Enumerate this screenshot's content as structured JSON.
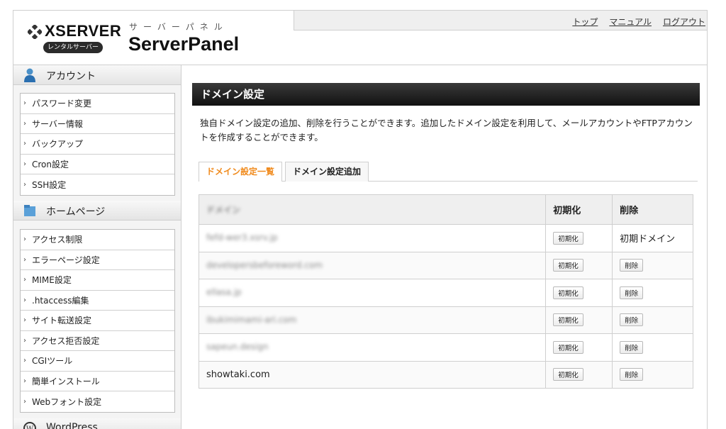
{
  "header": {
    "brand": "XSERVER",
    "rental_badge": "レンタルサーバー",
    "panel_sub": "サーバーパネル",
    "panel_title": "ServerPanel",
    "links": [
      "トップ",
      "マニュアル",
      "ログアウト"
    ]
  },
  "sidebar": {
    "sections": [
      {
        "title": "アカウント",
        "icon": "person-icon",
        "items": [
          "パスワード変更",
          "サーバー情報",
          "バックアップ",
          "Cron設定",
          "SSH設定"
        ]
      },
      {
        "title": "ホームページ",
        "icon": "folder-icon",
        "items": [
          "アクセス制限",
          "エラーページ設定",
          "MIME設定",
          ".htaccess編集",
          "サイト転送設定",
          "アクセス拒否設定",
          "CGIツール",
          "簡単インストール",
          "Webフォント設定"
        ]
      },
      {
        "title": "WordPress",
        "icon": "wordpress-icon",
        "items": []
      }
    ]
  },
  "main": {
    "title": "ドメイン設定",
    "description": "独自ドメイン設定の追加、削除を行うことができます。追加したドメイン設定を利用して、メールアカウントやFTPアカウントを作成することができます。",
    "tabs": [
      "ドメイン設定一覧",
      "ドメイン設定追加"
    ],
    "active_tab": 0,
    "table": {
      "headers": [
        "ドメイン",
        "初期化",
        "削除"
      ],
      "rows": [
        {
          "domain": "fefd-wer3.xsrv.jp",
          "blurred": true,
          "init_label": "初期化",
          "delete_label": "初期ドメイン",
          "delete_is_text": true
        },
        {
          "domain": "developersbeforeword.com",
          "blurred": true,
          "init_label": "初期化",
          "delete_label": "削除",
          "delete_is_text": false
        },
        {
          "domain": "ellasa.jp",
          "blurred": true,
          "init_label": "初期化",
          "delete_label": "削除",
          "delete_is_text": false
        },
        {
          "domain": "ibukimimami-ari.com",
          "blurred": true,
          "init_label": "初期化",
          "delete_label": "削除",
          "delete_is_text": false
        },
        {
          "domain": "sapeun.design",
          "blurred": true,
          "init_label": "初期化",
          "delete_label": "削除",
          "delete_is_text": false
        },
        {
          "domain": "showtaki.com",
          "blurred": false,
          "init_label": "初期化",
          "delete_label": "削除",
          "delete_is_text": false
        }
      ]
    }
  },
  "colors": {
    "active_tab": "#f08a1c",
    "title_bar": "#1a1a1a"
  }
}
